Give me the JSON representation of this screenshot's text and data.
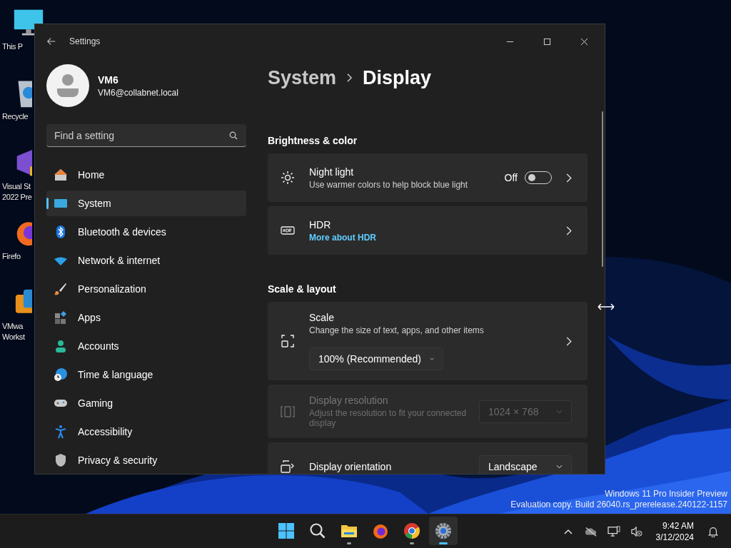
{
  "desktop": {
    "icons": [
      {
        "kind": "monitor",
        "lines": [
          "This P"
        ]
      },
      {
        "kind": "recycle-bin",
        "lines": [
          "Recycle"
        ]
      },
      {
        "kind": "visual-studio",
        "lines": [
          "Visual St",
          "2022 Pre"
        ]
      },
      {
        "kind": "firefox",
        "lines": [
          "Firefo"
        ]
      },
      {
        "kind": "vmware",
        "lines": [
          "VMwa",
          "Workst"
        ]
      }
    ],
    "watermark": [
      "Windows 11 Pro Insider Preview",
      "Evaluation copy. Build 26040.rs_prerelease.240122-1157"
    ]
  },
  "window": {
    "title": "Settings",
    "user": {
      "name": "VM6",
      "email": "VM6@collabnet.local"
    },
    "search": {
      "placeholder": "Find a setting"
    },
    "nav": [
      {
        "kind": "home",
        "label": "Home",
        "selected": false
      },
      {
        "kind": "system",
        "label": "System",
        "selected": true
      },
      {
        "kind": "bluetooth",
        "label": "Bluetooth & devices",
        "selected": false
      },
      {
        "kind": "network",
        "label": "Network & internet",
        "selected": false
      },
      {
        "kind": "brush",
        "label": "Personalization",
        "selected": false
      },
      {
        "kind": "apps",
        "label": "Apps",
        "selected": false
      },
      {
        "kind": "accounts",
        "label": "Accounts",
        "selected": false
      },
      {
        "kind": "time",
        "label": "Time & language",
        "selected": false
      },
      {
        "kind": "gaming",
        "label": "Gaming",
        "selected": false
      },
      {
        "kind": "accessibility",
        "label": "Accessibility",
        "selected": false
      },
      {
        "kind": "shield",
        "label": "Privacy & security",
        "selected": false
      }
    ],
    "breadcrumb": {
      "parent": "System",
      "current": "Display"
    },
    "sections": [
      {
        "title": "Brightness & color",
        "cards": [
          {
            "kind": "sun",
            "title": "Night light",
            "subtitle": "Use warmer colors to help block blue light",
            "disabled": false,
            "toggle": {
              "label": "Off",
              "on": false
            },
            "chevron": true
          },
          {
            "kind": "hdr",
            "title": "HDR",
            "link": "More about HDR",
            "disabled": false,
            "chevron": true
          }
        ]
      },
      {
        "title": "Scale & layout",
        "cards": [
          {
            "kind": "scale",
            "title": "Scale",
            "subtitle": "Change the size of text, apps, and other items",
            "disabled": false,
            "below_dropdown": "100% (Recommended)",
            "chevron": true
          },
          {
            "kind": "resolution",
            "title": "Display resolution",
            "subtitle": "Adjust the resolution to fit your connected display",
            "disabled": true,
            "dropdown": "1024 × 768",
            "chevron": false
          },
          {
            "kind": "orientation",
            "title": "Display orientation",
            "disabled": false,
            "dropdown": "Landscape",
            "chevron": false
          }
        ]
      }
    ]
  },
  "taskbar": {
    "apps": [
      {
        "kind": "start",
        "running": false,
        "selected": false
      },
      {
        "kind": "search",
        "running": false,
        "selected": false
      },
      {
        "kind": "explorer",
        "running": true,
        "selected": false
      },
      {
        "kind": "firefox",
        "running": false,
        "selected": false
      },
      {
        "kind": "chrome",
        "running": true,
        "selected": false
      },
      {
        "kind": "settings",
        "running": true,
        "selected": true
      }
    ],
    "time": "9:42 AM",
    "date": "3/12/2024"
  }
}
